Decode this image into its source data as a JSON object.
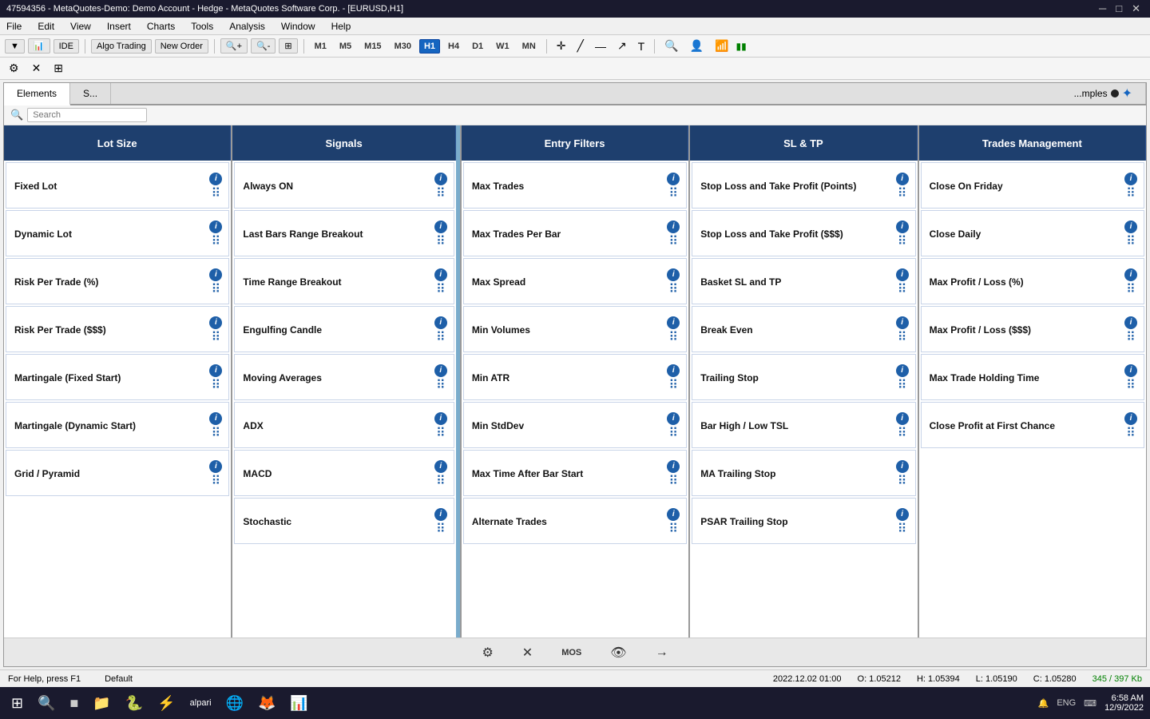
{
  "titleBar": {
    "text": "47594356 - MetaQuotes-Demo: Demo Account - Hedge - MetaQuotes Software Corp. - [EURUSD,H1]",
    "controls": [
      "─",
      "□",
      "✕"
    ]
  },
  "menuBar": {
    "items": [
      "File",
      "Edit",
      "View",
      "Insert",
      "Charts",
      "Tools",
      "Analysis",
      "Window",
      "Help"
    ]
  },
  "toolbar1": {
    "buttons": [
      "IDE",
      "Algo Trading",
      "New Order"
    ],
    "timeframes": [
      "M1",
      "M5",
      "M15",
      "M30",
      "H1",
      "H4",
      "D1",
      "W1",
      "MN"
    ],
    "activeTimeframe": "H1"
  },
  "toolbar2": {
    "tools": [
      "⊕",
      "✕",
      "⊞"
    ]
  },
  "panel": {
    "tabs": [
      "Elements",
      "S...",
      "...mples"
    ],
    "activeTab": "Elements",
    "search": {
      "placeholder": "Search",
      "value": ""
    },
    "columns": [
      {
        "id": "lot-size",
        "header": "Lot Size",
        "items": [
          {
            "id": "fixed-lot",
            "label": "Fixed Lot"
          },
          {
            "id": "dynamic-lot",
            "label": "Dynamic Lot"
          },
          {
            "id": "risk-per-trade-pct",
            "label": "Risk Per Trade (%)"
          },
          {
            "id": "risk-per-trade-ddd",
            "label": "Risk Per Trade ($$$)"
          },
          {
            "id": "martingale-fixed",
            "label": "Martingale (Fixed Start)"
          },
          {
            "id": "martingale-dynamic",
            "label": "Martingale (Dynamic Start)"
          },
          {
            "id": "grid-pyramid",
            "label": "Grid / Pyramid"
          }
        ]
      },
      {
        "id": "signals",
        "header": "Signals",
        "items": [
          {
            "id": "always-on",
            "label": "Always ON"
          },
          {
            "id": "last-bars-breakout",
            "label": "Last Bars Range Breakout"
          },
          {
            "id": "time-range-breakout",
            "label": "Time Range Breakout"
          },
          {
            "id": "engulfing-candle",
            "label": "Engulfing Candle"
          },
          {
            "id": "moving-averages",
            "label": "Moving Averages"
          },
          {
            "id": "adx",
            "label": "ADX"
          },
          {
            "id": "macd",
            "label": "MACD"
          },
          {
            "id": "stochastic",
            "label": "Stochastic"
          }
        ]
      },
      {
        "id": "entry-filters",
        "header": "Entry Filters",
        "items": [
          {
            "id": "max-trades",
            "label": "Max Trades"
          },
          {
            "id": "max-trades-per-bar",
            "label": "Max Trades Per Bar"
          },
          {
            "id": "max-spread",
            "label": "Max Spread"
          },
          {
            "id": "min-volumes",
            "label": "Min Volumes"
          },
          {
            "id": "min-atr",
            "label": "Min ATR"
          },
          {
            "id": "min-stddev",
            "label": "Min StdDev"
          },
          {
            "id": "max-time-after-bar",
            "label": "Max Time After Bar Start"
          },
          {
            "id": "alternate-trades",
            "label": "Alternate Trades"
          }
        ]
      },
      {
        "id": "sl-tp",
        "header": "SL & TP",
        "items": [
          {
            "id": "sl-tp-points",
            "label": "Stop Loss and Take Profit (Points)"
          },
          {
            "id": "sl-tp-ddd",
            "label": "Stop Loss and Take Profit ($$$)"
          },
          {
            "id": "basket-sl-tp",
            "label": "Basket SL and TP"
          },
          {
            "id": "break-even",
            "label": "Break Even"
          },
          {
            "id": "trailing-stop",
            "label": "Trailing Stop"
          },
          {
            "id": "bar-high-low-tsl",
            "label": "Bar High / Low TSL"
          },
          {
            "id": "ma-trailing-stop",
            "label": "MA Trailing Stop"
          },
          {
            "id": "psar-trailing-stop",
            "label": "PSAR Trailing Stop"
          }
        ]
      },
      {
        "id": "trades-management",
        "header": "Trades Management",
        "items": [
          {
            "id": "close-on-friday",
            "label": "Close On Friday"
          },
          {
            "id": "close-daily",
            "label": "Close Daily"
          },
          {
            "id": "max-profit-loss-pct",
            "label": "Max Profit / Loss (%)"
          },
          {
            "id": "max-profit-loss-ddd",
            "label": "Max Profit / Loss ($$$)"
          },
          {
            "id": "max-trade-holding-time",
            "label": "Max Trade Holding Time"
          },
          {
            "id": "close-profit-first-chance",
            "label": "Close Profit at First Chance"
          }
        ]
      }
    ]
  },
  "bottomBar": {
    "buttons": [
      "⚙",
      "✕",
      "M0S",
      "👁",
      "→"
    ]
  },
  "statusBar": {
    "help": "For Help, press F1",
    "mode": "Default",
    "date": "2022.12.02 01:00",
    "open": "O: 1.05212",
    "high": "H: 1.05394",
    "low": "L: 1.05190",
    "close": "C: 1.05280",
    "mem": "345 / 397 Kb"
  },
  "taskbar": {
    "startIcon": "⊞",
    "icons": [
      "🔍",
      "■",
      "📁",
      "🐍",
      "⚡",
      "🌐",
      "🦋",
      "📊"
    ],
    "systemTray": {
      "lang": "ENG",
      "time": "6:58 AM",
      "date": "12/9/2022"
    }
  }
}
